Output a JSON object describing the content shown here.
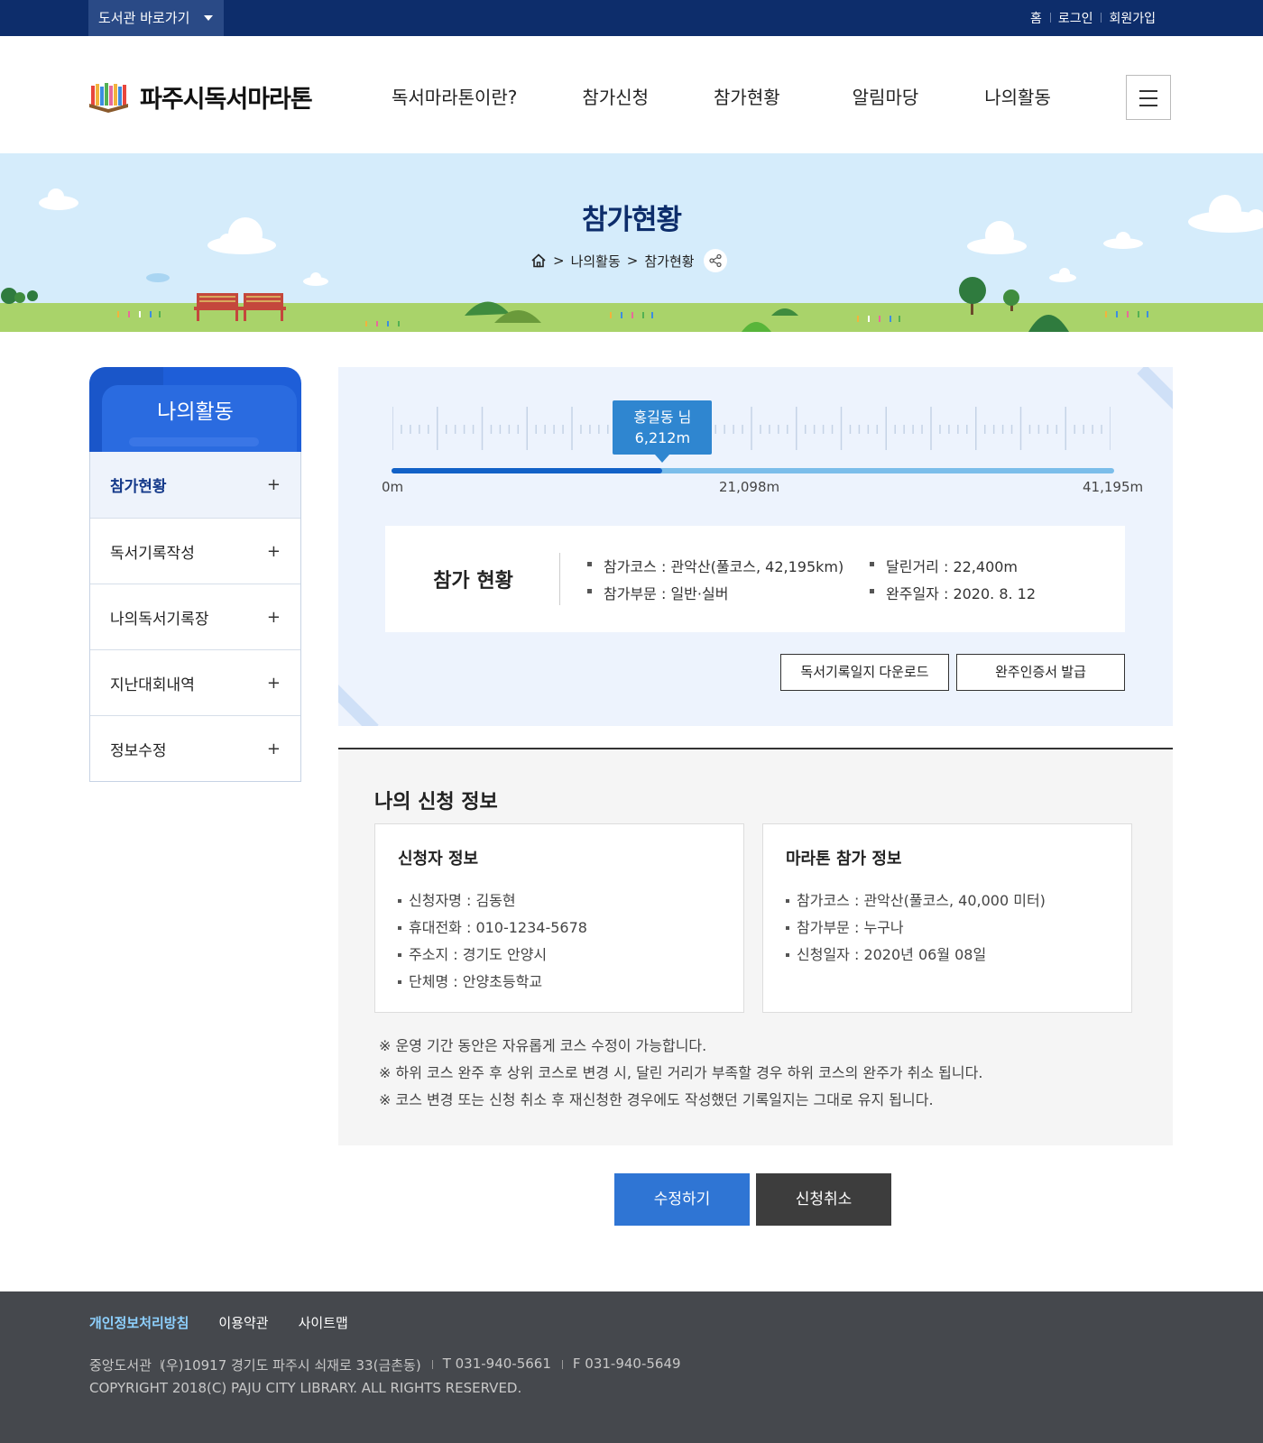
{
  "topbar": {
    "library_shortcut": "도서관 바로가기",
    "links": [
      "홈",
      "로그인",
      "회원가입"
    ]
  },
  "header": {
    "logo_text": "파주시독서마라톤",
    "nav": [
      "독서마라톤이란?",
      "참가신청",
      "참가현황",
      "알림마당",
      "나의활동"
    ]
  },
  "banner": {
    "title": "참가현황",
    "breadcrumb": [
      "나의활동",
      "참가현황"
    ]
  },
  "lnb": {
    "title": "나의활동",
    "items": [
      "참가현황",
      "독서기록작성",
      "나의독서기록장",
      "지난대회내역",
      "정보수정"
    ],
    "active_index": 0
  },
  "progress": {
    "runner_name": "홍길동 님",
    "runner_distance": "6,212m",
    "ticks": [
      "0m",
      "21,098m",
      "41,195m"
    ],
    "fraction": 0.375
  },
  "status": {
    "title": "참가 현황",
    "course": "참가코스 : 관악산(풀코스, 42,195km)",
    "division": "참가부문 : 일반·실버",
    "distance": "달린거리 : 22,400m",
    "finish_date": "완주일자 : 2020. 8. 12",
    "download_button": "독서기록일지 다운로드",
    "certificate_button": "완주인증서 발급"
  },
  "apply": {
    "title": "나의 신청 정보",
    "applicant": {
      "title": "신청자 정보",
      "lines": [
        "신청자명 : 김동현",
        "휴대전화 : 010-1234-5678",
        "주소지 : 경기도 안양시",
        "단체명 : 안양초등학교"
      ]
    },
    "marathon": {
      "title": "마라톤 참가 정보",
      "lines": [
        "참가코스 : 관악산(풀코스, 40,000 미터)",
        "참가부문 : 누구나",
        "신청일자 : 2020년 06월 08일"
      ]
    },
    "notes": [
      "※ 운영 기간 동안은 자유롭게 코스 수정이 가능합니다.",
      "※ 하위 코스 완주 후 상위 코스로 변경 시, 달린 거리가 부족할 경우 하위 코스의 완주가 취소 됩니다.",
      "※ 코스 변경 또는 신청 취소 후 재신청한 경우에도 작성했던 기록일지는 그대로 유지 됩니다."
    ],
    "edit_button": "수정하기",
    "cancel_button": "신청취소"
  },
  "footer": {
    "links": [
      "개인정보처리방침",
      "이용약관",
      "사이트맵"
    ],
    "library": "중앙도서관",
    "address": "(우)10917 경기도 파주시 쇠재로 33(금촌동)",
    "tel": "T 031-940-5661",
    "fax": "F 031-940-5649",
    "copyright": "COPYRIGHT 2018(C) PAJU CITY LIBRARY. ALL RIGHTS RESERVED."
  },
  "colors": {
    "navy": "#0d2d6b",
    "primary_blue": "#1e5ed8",
    "progress_blue": "#1261c7",
    "edit_button": "#2f75d4",
    "cancel_button": "#3d3d3d",
    "footer": "#45484d"
  }
}
